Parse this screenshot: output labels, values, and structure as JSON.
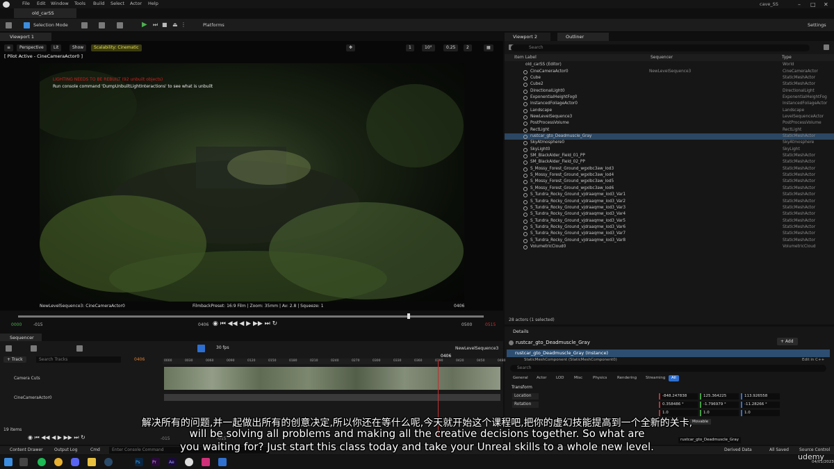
{
  "menu": {
    "items": [
      "File",
      "Edit",
      "Window",
      "Tools",
      "Build",
      "Select",
      "Actor",
      "Help"
    ],
    "project_tab": "old_carSS",
    "project_right": "cave_SS"
  },
  "toolbar": {
    "selection_mode": "Selection Mode",
    "platforms": "Platforms",
    "settings": "Settings"
  },
  "viewport": {
    "tab": "Viewport 1",
    "perspective": "Perspective",
    "lit": "Lit",
    "show": "Show",
    "scalability": "Scalability: Cinematic",
    "pilot": "[ Pilot Active - CineCameraActor0 ]",
    "warning_red": "LIGHTING NEEDS TO BE REBUILT (92 unbuilt objects)",
    "warning_white": "Run console command 'DumpUnbuiltLightInteractions' to see what is unbuilt",
    "footer_left": "NewLevelSequence3: CineCameraActor0",
    "footer_center": "FilmbackPreset: 16:9 Film | Zoom: 35mm | Av: 2.8 | Squeeze: 1",
    "footer_right": "0406",
    "snap_grid": "1",
    "snap_rot": "10°",
    "snap_scale": "0.25",
    "cam_speed": "2",
    "timeline": {
      "start_green": "0000",
      "start_red": "-015",
      "current": "0406",
      "end_red": "0500",
      "end": "0515"
    }
  },
  "right_tabs": {
    "viewport2": "Viewport 2",
    "outliner": "Outliner"
  },
  "outliner": {
    "search_placeholder": "Search",
    "headers": {
      "label": "Item Label",
      "sequencer": "Sequencer",
      "type": "Type"
    },
    "root": {
      "name": "old_carSS (Editor)",
      "type": "World"
    },
    "rows": [
      {
        "name": "CineCameraActor0",
        "seq": "NewLevelSequence3",
        "type": "CineCameraActor"
      },
      {
        "name": "Cube",
        "seq": "",
        "type": "StaticMeshActor"
      },
      {
        "name": "Cube2",
        "seq": "",
        "type": "StaticMeshActor"
      },
      {
        "name": "DirectionalLight0",
        "seq": "",
        "type": "DirectionalLight"
      },
      {
        "name": "ExponentialHeightFog0",
        "seq": "",
        "type": "ExponentialHeightFog"
      },
      {
        "name": "InstancedFoliageActor0",
        "seq": "",
        "type": "InstancedFoliageActor"
      },
      {
        "name": "Landscape",
        "seq": "",
        "type": "Landscape"
      },
      {
        "name": "NewLevelSequence3",
        "seq": "",
        "type": "LevelSequenceActor"
      },
      {
        "name": "PostProcessVolume",
        "seq": "",
        "type": "PostProcessVolume"
      },
      {
        "name": "RectLight",
        "seq": "",
        "type": "RectLight"
      },
      {
        "name": "rustcar_gto_Deadmuscle_Gray",
        "seq": "",
        "type": "StaticMeshActor"
      },
      {
        "name": "SkyAtmosphere0",
        "seq": "",
        "type": "SkyAtmosphere"
      },
      {
        "name": "SkyLight0",
        "seq": "",
        "type": "SkyLight"
      },
      {
        "name": "SM_BlackAlder_Field_01_PP",
        "seq": "",
        "type": "StaticMeshActor"
      },
      {
        "name": "SM_BlackAlder_Field_02_PP",
        "seq": "",
        "type": "StaticMeshActor"
      },
      {
        "name": "S_Mossy_Forest_Ground_wgxlbc3aw_lod3",
        "seq": "",
        "type": "StaticMeshActor"
      },
      {
        "name": "S_Mossy_Forest_Ground_wgxlbc3aw_lod4",
        "seq": "",
        "type": "StaticMeshActor"
      },
      {
        "name": "S_Mossy_Forest_Ground_wgxlbc3aw_lod5",
        "seq": "",
        "type": "StaticMeshActor"
      },
      {
        "name": "S_Mossy_Forest_Ground_wgxlbc3aw_lod6",
        "seq": "",
        "type": "StaticMeshActor"
      },
      {
        "name": "S_Tundra_Rocky_Ground_vjdraaqmw_lod3_Var1",
        "seq": "",
        "type": "StaticMeshActor"
      },
      {
        "name": "S_Tundra_Rocky_Ground_vjdraaqmw_lod3_Var2",
        "seq": "",
        "type": "StaticMeshActor"
      },
      {
        "name": "S_Tundra_Rocky_Ground_vjdraaqmw_lod3_Var3",
        "seq": "",
        "type": "StaticMeshActor"
      },
      {
        "name": "S_Tundra_Rocky_Ground_vjdraaqmw_lod3_Var4",
        "seq": "",
        "type": "StaticMeshActor"
      },
      {
        "name": "S_Tundra_Rocky_Ground_vjdraaqmw_lod3_Var5",
        "seq": "",
        "type": "StaticMeshActor"
      },
      {
        "name": "S_Tundra_Rocky_Ground_vjdraaqmw_lod3_Var6",
        "seq": "",
        "type": "StaticMeshActor"
      },
      {
        "name": "S_Tundra_Rocky_Ground_vjdraaqmw_lod3_Var7",
        "seq": "",
        "type": "StaticMeshActor"
      },
      {
        "name": "S_Tundra_Rocky_Ground_vjdraaqmw_lod3_Var8",
        "seq": "",
        "type": "StaticMeshActor"
      },
      {
        "name": "VolumetricCloud0",
        "seq": "",
        "type": "VolumetricCloud"
      }
    ],
    "selected_index": 10,
    "count": "28 actors (1 selected)"
  },
  "details": {
    "tab": "Details",
    "title": "rustcar_gto_Deadmuscle_Gray",
    "add": "+ Add",
    "instance": "rustcar_gto_Deadmuscle_Gray (Instance)",
    "component": "StaticMeshComponent (StaticMeshComponent0)",
    "edit_cpp": "Edit in C++",
    "search_placeholder": "Search",
    "tabs": [
      "General",
      "Actor",
      "LOD",
      "Misc",
      "Physics",
      "Rendering",
      "Streaming",
      "All"
    ],
    "transform": "Transform",
    "location_label": "Location",
    "location": [
      "-848.247838",
      "125.364225",
      "113.926558"
    ],
    "rotation_label": "Rotation",
    "rotation": [
      "0.358486 °",
      "-1.796979 °",
      "-11.28266 °"
    ],
    "scale": [
      "1.0",
      "1.0",
      "1.0"
    ],
    "movable": "Movable",
    "mesh": "rustcar_gto_Deadmuscle_Gray"
  },
  "sequencer": {
    "tab": "Sequencer",
    "fps": "30 fps",
    "name": "NewLevelSequence3",
    "track": "+ Track",
    "search_placeholder": "Search Tracks",
    "frame": "0406",
    "ruler": [
      "0000",
      "0030",
      "0060",
      "0090",
      "0120",
      "0150",
      "0180",
      "0210",
      "0240",
      "0270",
      "0300",
      "0330",
      "0360",
      "0390",
      "0420",
      "0450",
      "0480"
    ],
    "head_frame": "0406",
    "tracks": [
      "Camera Cuts",
      "CineCameraActor0"
    ],
    "items": "19 items",
    "frame_start": "-015",
    "frame_end": "-015"
  },
  "statusbar": {
    "content_drawer": "Content Drawer",
    "output_log": "Output Log",
    "cmd": "Cmd",
    "cmd_placeholder": "Enter Console Command",
    "derived": "Derived Data",
    "saved": "All Saved",
    "source": "Source Control"
  },
  "taskbar": {
    "date": "04/01/2023"
  },
  "subtitles": {
    "cn": "解决所有的问题,并一起做出所有的创意决定,所以你还在等什么呢,今天就开始这个课程吧,把你的虚幻技能提高到一个全新的关卡,",
    "en1": "will be solving all problems and making all the creative decisions together. So what are",
    "en2": "you waiting for? Just start this class today and take your Unreal skills to a whole new level."
  },
  "watermark": "udemy",
  "colors": {
    "accent": "#2d6fd0",
    "selected_row": "#2b4763",
    "warning": "#d02020",
    "play_green": "#4caf50"
  }
}
